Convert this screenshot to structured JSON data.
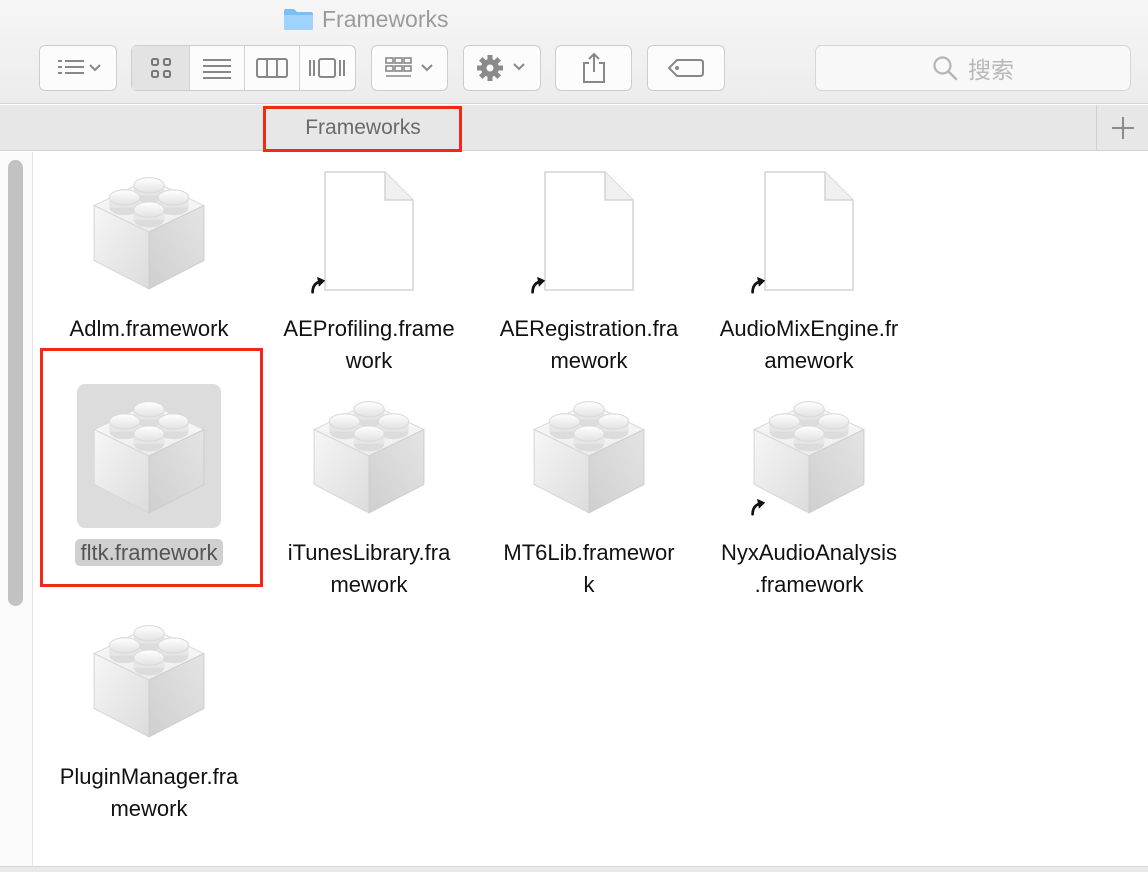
{
  "window": {
    "title": "Frameworks"
  },
  "toolbar": {
    "search_placeholder": "搜索"
  },
  "tabbar": {
    "tab_label": "Frameworks"
  },
  "items": [
    {
      "label_line1": "Adlm.framework",
      "label_line2": "",
      "icon": "lego-brick-icon"
    },
    {
      "label_line1": "AEProfiling.frame",
      "label_line2": "work",
      "icon": "document-alias-icon"
    },
    {
      "label_line1": "AERegistration.fra",
      "label_line2": "mework",
      "icon": "document-alias-icon"
    },
    {
      "label_line1": "AudioMixEngine.fr",
      "label_line2": "amework",
      "icon": "document-alias-icon"
    },
    {
      "label_line1": "fltk.framework",
      "label_line2": "",
      "icon": "lego-brick-icon",
      "selected": true
    },
    {
      "label_line1": "iTunesLibrary.fra",
      "label_line2": "mework",
      "icon": "lego-brick-icon"
    },
    {
      "label_line1": "MT6Lib.framewor",
      "label_line2": "k",
      "icon": "lego-brick-icon"
    },
    {
      "label_line1": "NyxAudioAnalysis",
      "label_line2": ".framework",
      "icon": "lego-brick-alias-icon"
    },
    {
      "label_line1": "PluginManager.fra",
      "label_line2": "mework",
      "icon": "lego-brick-icon"
    }
  ],
  "colors": {
    "highlight_red": "#f02a14",
    "selection_gray": "#dcdcdc",
    "folder_blue": "#7ac0f5"
  }
}
